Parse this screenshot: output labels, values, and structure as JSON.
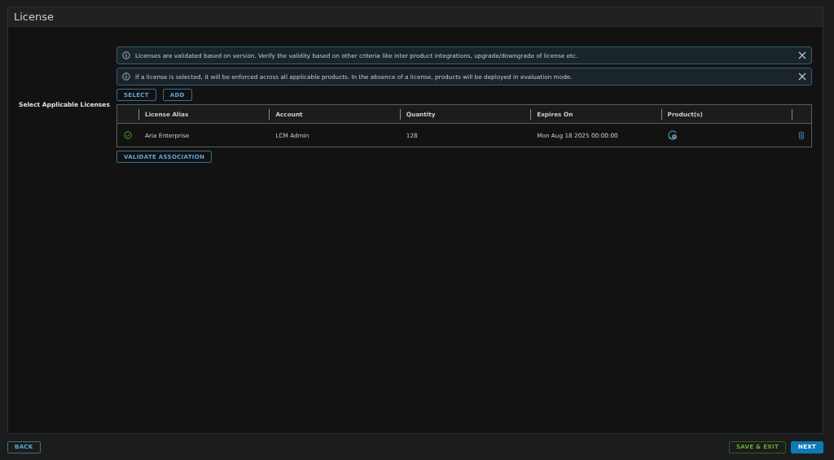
{
  "panel": {
    "title": "License"
  },
  "section_label": "Select Applicable Licenses",
  "alerts": [
    {
      "text": "Licenses are validated based on version. Verify the validity based on other criteria like inter product integrations, upgrade/downgrade of license etc."
    },
    {
      "text": "If a license is selected, it will be enforced across all applicable products. In the absence of a license, products will be deployed in evaluation mode."
    }
  ],
  "actions": [
    "SELECT",
    "ADD"
  ],
  "table": {
    "columns": [
      "License Alias",
      "Account",
      "Quantity",
      "Expires On",
      "Product(s)"
    ],
    "rows": [
      {
        "valid": true,
        "cells": [
          "Aria Enterprise",
          "LCM Admin",
          "128",
          "Mon Aug 18 2025 00:00:00"
        ]
      }
    ]
  },
  "validate_button": "VALIDATE ASSOCIATION",
  "footer": {
    "back": "BACK",
    "save_exit": "SAVE & EXIT",
    "next": "NEXT"
  }
}
